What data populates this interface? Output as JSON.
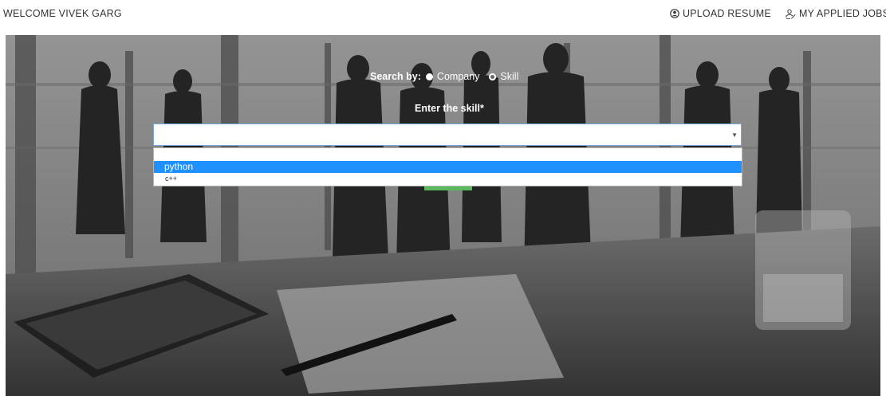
{
  "header": {
    "welcome": "WELCOME VIVEK GARG",
    "upload_resume": "UPLOAD RESUME",
    "my_applied_jobs": "MY APPLIED JOBS"
  },
  "search": {
    "search_by_label": "Search by:",
    "options": [
      {
        "label": "Company",
        "checked": false
      },
      {
        "label": "Skill",
        "checked": true
      }
    ],
    "skill_label": "Enter the skill*",
    "select_value": "",
    "dropdown_options": [
      "",
      "python",
      "c++"
    ],
    "highlighted_option": "python"
  },
  "colors": {
    "highlight": "#1e90ff",
    "submit_button": "#5cb85c",
    "select_border": "#7aa7d6"
  }
}
